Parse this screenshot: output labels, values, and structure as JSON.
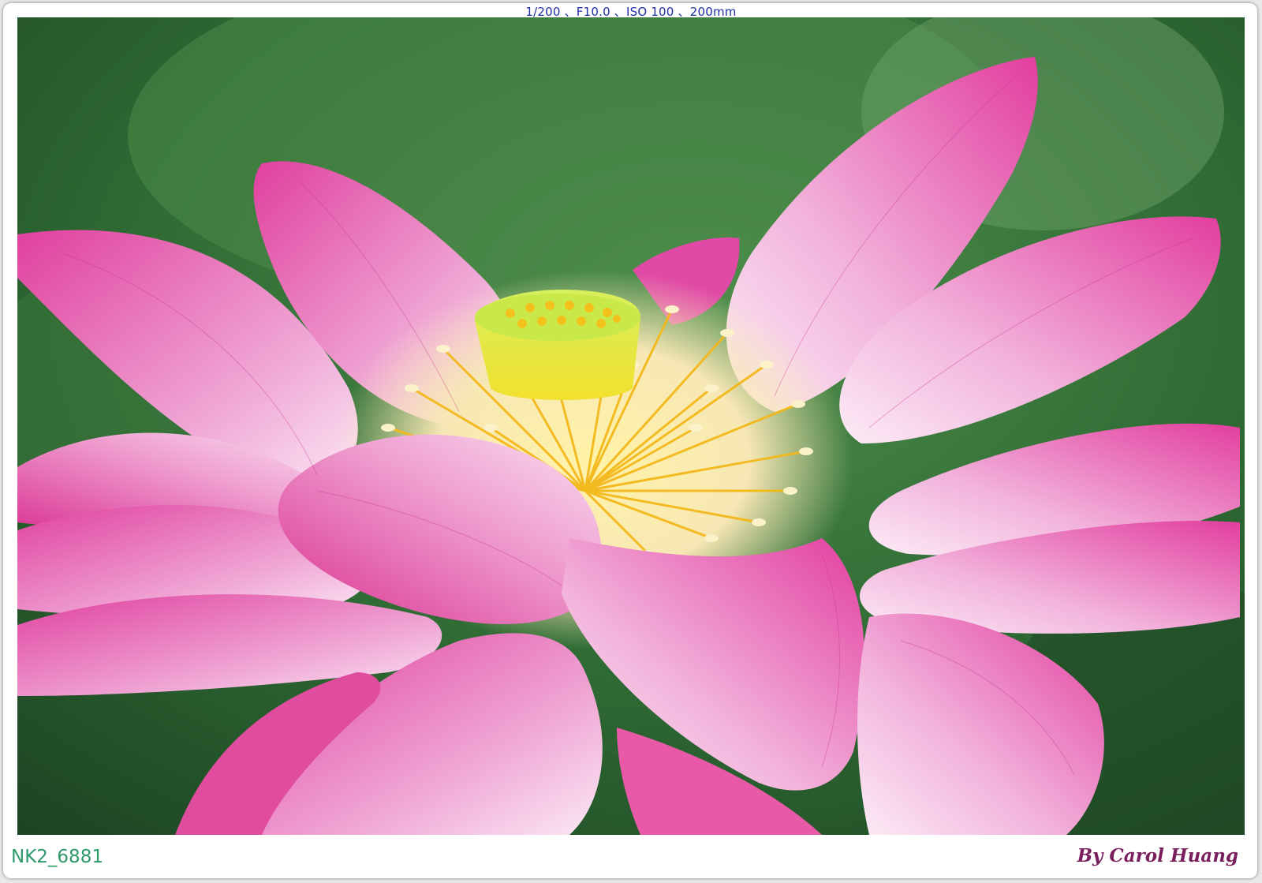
{
  "header": {
    "exif": "1/200 、F10.0 、ISO 100 、200mm"
  },
  "footer": {
    "file_id": "NK2_6881",
    "signature": "By Carol Huang"
  },
  "photo": {
    "subject": "pink-lotus-flower",
    "colors": {
      "background_green": "#2f6b34",
      "leaf_light": "#5f9d5c",
      "petal_pink": "#e0409e",
      "petal_light": "#f7d9ee",
      "stamen_yellow": "#f5c21e",
      "seedpod_green": "#c9e84a"
    }
  }
}
